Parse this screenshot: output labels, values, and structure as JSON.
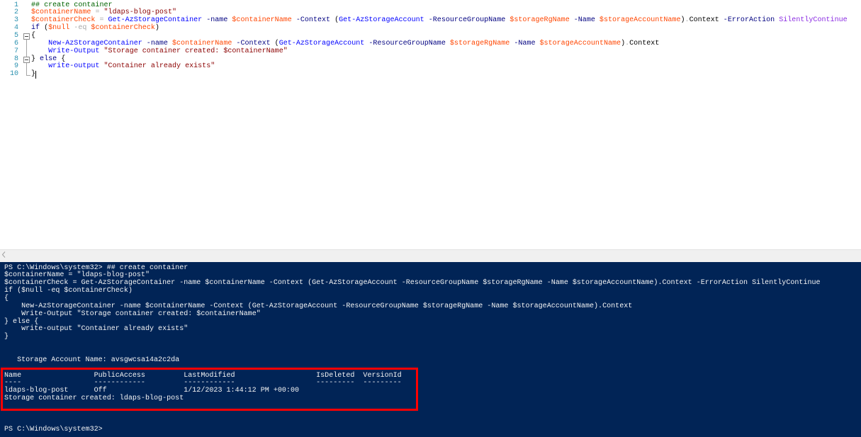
{
  "colors": {
    "editor_background": "#ffffff",
    "line_number": "#2b91af",
    "console_background": "#012456",
    "console_text": "#f5f5f5",
    "highlight_box": "#ff0000"
  },
  "editor": {
    "syntax_colors": {
      "comment": "#006400",
      "variable": "#ff4500",
      "operator": "#a9a9a9",
      "string": "#8b0000",
      "command": "#0000ff",
      "parameter": "#000080",
      "argument": "#8a2be2",
      "keyword": "#00008b",
      "member": "#000000",
      "group": "#000000",
      "plain": "#000000"
    },
    "lines": [
      {
        "num": "1",
        "tokens": [
          {
            "comment": "## create container"
          }
        ]
      },
      {
        "num": "2",
        "tokens": [
          {
            "variable": "$containerName"
          },
          {
            "operator": " = "
          },
          {
            "string": "\"ldaps-blog-post\""
          }
        ]
      },
      {
        "num": "3",
        "tokens": [
          {
            "variable": "$containerCheck"
          },
          {
            "operator": " = "
          },
          {
            "command": "Get-AzStorageContainer"
          },
          {
            "parameter": " -name"
          },
          {
            "variable": " $containerName"
          },
          {
            "parameter": " -Context"
          },
          {
            "group": " ("
          },
          {
            "command": "Get-AzStorageAccount"
          },
          {
            "parameter": " -ResourceGroupName"
          },
          {
            "variable": " $storageRgName"
          },
          {
            "parameter": " -Name"
          },
          {
            "variable": " $storageAccountName"
          },
          {
            "group": ")"
          },
          {
            "operator": "."
          },
          {
            "member": "Context"
          },
          {
            "parameter": " -ErrorAction"
          },
          {
            "argument": " SilentlyContinue"
          }
        ]
      },
      {
        "num": "4",
        "tokens": [
          {
            "keyword": "if"
          },
          {
            "group": " ("
          },
          {
            "variable": "$null"
          },
          {
            "operator": " -eq"
          },
          {
            "variable": " $containerCheck"
          },
          {
            "group": ")"
          }
        ]
      },
      {
        "num": "5",
        "fold": true,
        "tokens": [
          {
            "group": "{"
          }
        ]
      },
      {
        "num": "6",
        "tokens": [
          {
            "plain": "    "
          },
          {
            "command": "New-AzStorageContainer"
          },
          {
            "parameter": " -name"
          },
          {
            "variable": " $containerName"
          },
          {
            "parameter": " -Context"
          },
          {
            "group": " ("
          },
          {
            "command": "Get-AzStorageAccount"
          },
          {
            "parameter": " -ResourceGroupName"
          },
          {
            "variable": " $storageRgName"
          },
          {
            "parameter": " -Name"
          },
          {
            "variable": " $storageAccountName"
          },
          {
            "group": ")"
          },
          {
            "operator": "."
          },
          {
            "member": "Context"
          }
        ]
      },
      {
        "num": "7",
        "tokens": [
          {
            "plain": "    "
          },
          {
            "command": "Write-Output"
          },
          {
            "string": " \"Storage container created: $containerName\""
          }
        ]
      },
      {
        "num": "8",
        "fold": true,
        "tokens": [
          {
            "group": "}"
          },
          {
            "keyword": " else"
          },
          {
            "group": " {"
          }
        ]
      },
      {
        "num": "9",
        "tokens": [
          {
            "plain": "    "
          },
          {
            "command": "write-output"
          },
          {
            "string": " \"Container already exists\""
          }
        ]
      },
      {
        "num": "10",
        "caret": true,
        "tokens": [
          {
            "group": "}"
          }
        ]
      }
    ]
  },
  "scrollbar": {
    "left_arrow_icon": "chevron-left-icon"
  },
  "console": {
    "prompt": "PS C:\\Windows\\system32>",
    "echoed_script": [
      "## create container",
      "$containerName = \"ldaps-blog-post\"",
      "$containerCheck = Get-AzStorageContainer -name $containerName -Context (Get-AzStorageAccount -ResourceGroupName $storageRgName -Name $storageAccountName).Context -ErrorAction SilentlyContinue",
      "if ($null -eq $containerCheck)",
      "{",
      "    New-AzStorageContainer -name $containerName -Context (Get-AzStorageAccount -ResourceGroupName $storageRgName -Name $storageAccountName).Context",
      "    Write-Output \"Storage container created: $containerName\"",
      "} else {",
      "    write-output \"Container already exists\"",
      "}"
    ],
    "storage_account": {
      "label": "Storage Account Name:",
      "value": "avsgwcsa14a2c2da"
    },
    "table": {
      "columns": [
        "Name",
        "PublicAccess",
        "LastModified",
        "IsDeleted",
        "VersionId"
      ],
      "underlines": [
        "----",
        "------------",
        "------------",
        "---------",
        "---------"
      ],
      "rows": [
        [
          "ldaps-blog-post",
          "Off",
          "1/12/2023 1:44:12 PM +00:00"
        ]
      ]
    },
    "result_line": "Storage container created: ldaps-blog-post"
  }
}
